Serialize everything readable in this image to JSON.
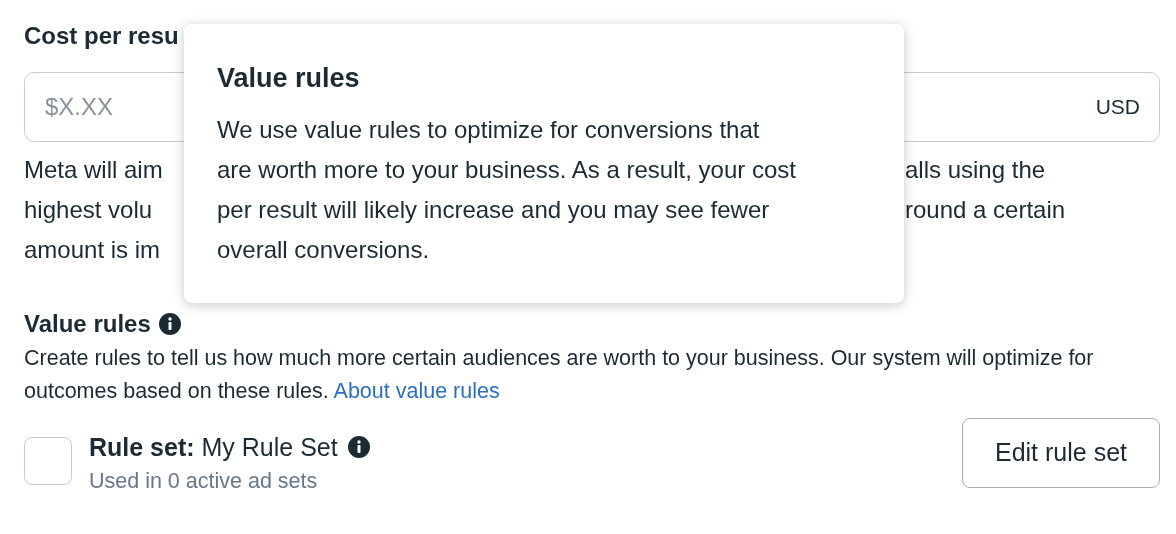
{
  "cost_field": {
    "label": "Cost per resu",
    "placeholder": "$X.XX",
    "currency": "USD"
  },
  "cost_help_lines": [
    {
      "left": "Meta will aim",
      "right": "alls using the"
    },
    {
      "left": "highest volu",
      "right": "round a certain"
    },
    {
      "left": "amount is im"
    }
  ],
  "value_rules": {
    "title": "Value rules",
    "description": "Create rules to tell us how much more certain audiences are worth to your business. Our system will optimize for outcomes based on these rules.",
    "link": "About value rules"
  },
  "rule_set": {
    "label": "Rule set:",
    "name": "My Rule Set",
    "usage": "Used in 0 active ad sets",
    "checked": false,
    "button": "Edit rule set"
  },
  "tooltip": {
    "title": "Value rules",
    "body": "We use value rules to optimize for conversions that are worth more to your business. As a result, your cost per result will likely increase and you may see fewer overall conversions."
  }
}
